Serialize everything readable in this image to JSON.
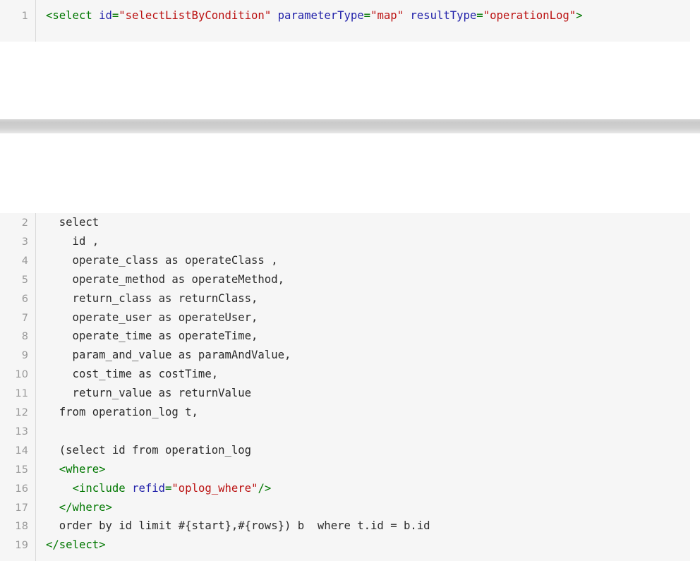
{
  "colors": {
    "code_background": "#f6f6f6",
    "line_number": "#999999",
    "tag": "#007700",
    "attribute": "#2222aa",
    "string": "#bb1111",
    "plain": "#2b2b2b"
  },
  "block_top": {
    "lines": [
      {
        "number": "1",
        "tokens": [
          {
            "type": "tag",
            "text": "<select "
          },
          {
            "type": "attr",
            "text": "id"
          },
          {
            "type": "tag",
            "text": "="
          },
          {
            "type": "str",
            "text": "\"selectListByCondition\""
          },
          {
            "type": "tag",
            "text": " "
          },
          {
            "type": "attr",
            "text": "parameterType"
          },
          {
            "type": "tag",
            "text": "="
          },
          {
            "type": "str",
            "text": "\"map\""
          },
          {
            "type": "tag",
            "text": " "
          },
          {
            "type": "attr",
            "text": "resultType"
          },
          {
            "type": "tag",
            "text": "="
          },
          {
            "type": "str",
            "text": "\"operationLog\""
          },
          {
            "type": "tag",
            "text": ">"
          }
        ]
      }
    ]
  },
  "block_bottom": {
    "lines": [
      {
        "number": "2",
        "tokens": [
          {
            "type": "plain",
            "text": "  select"
          }
        ]
      },
      {
        "number": "3",
        "tokens": [
          {
            "type": "plain",
            "text": "    id ,"
          }
        ]
      },
      {
        "number": "4",
        "tokens": [
          {
            "type": "plain",
            "text": "    operate_class as operateClass ,"
          }
        ]
      },
      {
        "number": "5",
        "tokens": [
          {
            "type": "plain",
            "text": "    operate_method as operateMethod,"
          }
        ]
      },
      {
        "number": "6",
        "tokens": [
          {
            "type": "plain",
            "text": "    return_class as returnClass,"
          }
        ]
      },
      {
        "number": "7",
        "tokens": [
          {
            "type": "plain",
            "text": "    operate_user as operateUser,"
          }
        ]
      },
      {
        "number": "8",
        "tokens": [
          {
            "type": "plain",
            "text": "    operate_time as operateTime,"
          }
        ]
      },
      {
        "number": "9",
        "tokens": [
          {
            "type": "plain",
            "text": "    param_and_value as paramAndValue,"
          }
        ]
      },
      {
        "number": "10",
        "tokens": [
          {
            "type": "plain",
            "text": "    cost_time as costTime,"
          }
        ]
      },
      {
        "number": "11",
        "tokens": [
          {
            "type": "plain",
            "text": "    return_value as returnValue"
          }
        ]
      },
      {
        "number": "12",
        "tokens": [
          {
            "type": "plain",
            "text": "  from operation_log t,"
          }
        ]
      },
      {
        "number": "13",
        "tokens": []
      },
      {
        "number": "14",
        "tokens": [
          {
            "type": "plain",
            "text": "  (select id from operation_log"
          }
        ]
      },
      {
        "number": "15",
        "tokens": [
          {
            "type": "plain",
            "text": "  "
          },
          {
            "type": "tag",
            "text": "<where>"
          }
        ]
      },
      {
        "number": "16",
        "tokens": [
          {
            "type": "plain",
            "text": "    "
          },
          {
            "type": "tag",
            "text": "<include "
          },
          {
            "type": "attr",
            "text": "refid"
          },
          {
            "type": "tag",
            "text": "="
          },
          {
            "type": "str",
            "text": "\"oplog_where\""
          },
          {
            "type": "tag",
            "text": "/>"
          }
        ]
      },
      {
        "number": "17",
        "tokens": [
          {
            "type": "plain",
            "text": "  "
          },
          {
            "type": "tag",
            "text": "</where>"
          }
        ]
      },
      {
        "number": "18",
        "tokens": [
          {
            "type": "plain",
            "text": "  order by id limit #{start},#{rows}) b  where t.id = b.id"
          }
        ]
      },
      {
        "number": "19",
        "tokens": [
          {
            "type": "tag",
            "text": "</select>"
          }
        ]
      }
    ]
  }
}
